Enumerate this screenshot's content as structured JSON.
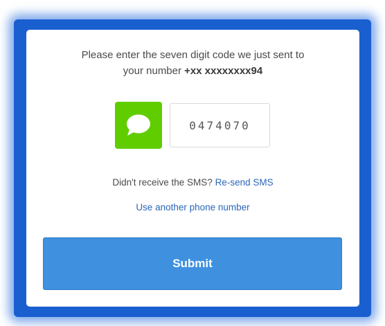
{
  "prompt": {
    "line1": "Please enter the seven digit code we just sent to",
    "line2_prefix": "your number ",
    "phone_number": "+xx xxxxxxxx94"
  },
  "code": {
    "value": "0474070",
    "icon": "sms-bubble-icon"
  },
  "resend": {
    "question": "Didn't receive the SMS?",
    "link_label": "Re-send SMS"
  },
  "another_phone": {
    "link_label": "Use another phone number"
  },
  "submit": {
    "label": "Submit"
  },
  "colors": {
    "frame": "#1a5fd0",
    "sms_icon_bg": "#5fcd00",
    "link": "#2a66b8",
    "submit_bg": "#3f91e0"
  }
}
